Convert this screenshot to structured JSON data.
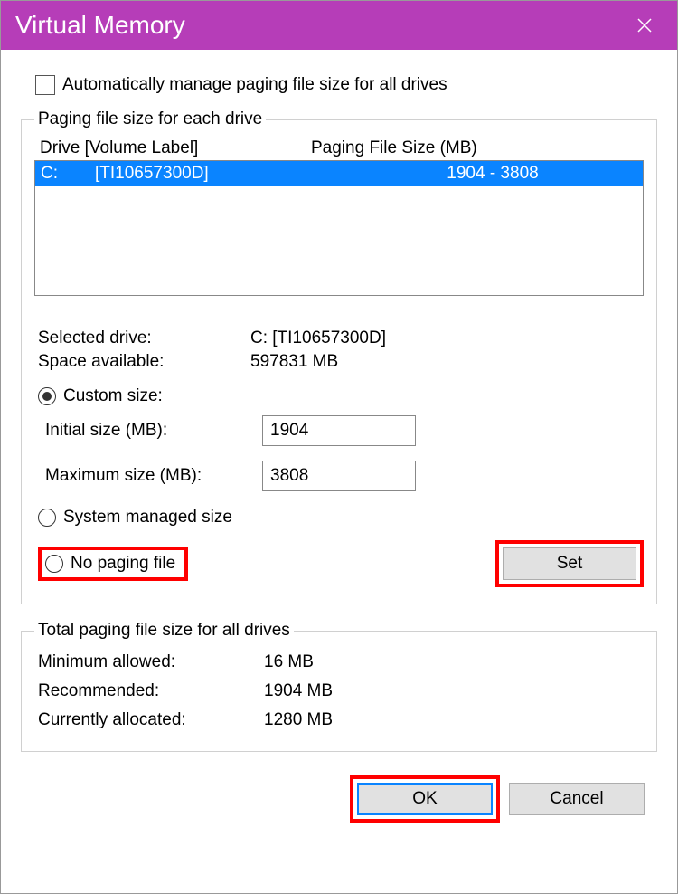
{
  "window": {
    "title": "Virtual Memory"
  },
  "auto_manage": {
    "label": "Automatically manage paging file size for all drives",
    "checked": false
  },
  "group_each_drive": {
    "legend": "Paging file size for each drive",
    "header_drive": "Drive  [Volume Label]",
    "header_size": "Paging File Size (MB)",
    "rows": [
      {
        "letter": "C:",
        "label": "[TI10657300D]",
        "size": "1904 - 3808",
        "selected": true
      }
    ],
    "selected_drive_label": "Selected drive:",
    "selected_drive_value": "C:  [TI10657300D]",
    "space_available_label": "Space available:",
    "space_available_value": "597831 MB",
    "radio_custom_label": "Custom size:",
    "initial_size_label": "Initial size (MB):",
    "initial_size_value": "1904",
    "maximum_size_label": "Maximum size (MB):",
    "maximum_size_value": "3808",
    "radio_system_label": "System managed size",
    "radio_none_label": "No paging file",
    "set_button": "Set",
    "selected_radio": "custom"
  },
  "group_total": {
    "legend": "Total paging file size for all drives",
    "min_label": "Minimum allowed:",
    "min_value": "16 MB",
    "rec_label": "Recommended:",
    "rec_value": "1904 MB",
    "cur_label": "Currently allocated:",
    "cur_value": "1280 MB"
  },
  "footer": {
    "ok": "OK",
    "cancel": "Cancel"
  }
}
